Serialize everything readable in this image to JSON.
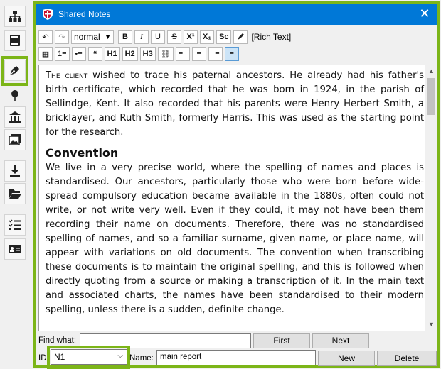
{
  "window": {
    "title": "Shared Notes",
    "close_glyph": "✕"
  },
  "rail": {
    "icons": [
      "tree-icon",
      "book-icon",
      "pen-nib-icon",
      "pin-icon",
      "museum-icon",
      "gallery-icon",
      "download-icon",
      "folder-open-icon",
      "checklist-icon",
      "id-card-icon"
    ]
  },
  "toolbar": {
    "undo": "↶",
    "redo": "↷",
    "style_select": "normal",
    "bold": "B",
    "italic": "I",
    "underline": "U",
    "strike": "S",
    "superscript": "X¹",
    "subscript": "X₁",
    "smallcaps": "Sc",
    "rich_text_label": "[Rich Text]",
    "table": "▦",
    "numbered_list": "1≡",
    "bullet_list": "•≡",
    "quote": "❝",
    "h1": "H1",
    "h2": "H2",
    "h3": "H3",
    "link": "⛓",
    "align_left": "≡",
    "align_center": "≡",
    "align_right": "≡",
    "align_justify": "≡"
  },
  "editor": {
    "para1_smallcaps": "The client",
    "para1_rest": " wished to trace his paternal ancestors. He already had his father's birth certificate, which recorded that he was born in 1924, in the parish of Sellindge, Kent. It also recorded that his parents were Henry Herbert Smith, a bricklayer, and Ruth Smith, formerly Harris. This was used as the starting point for the research.",
    "heading": "Convention",
    "para2": "We live in a very precise world, where the spelling of names and places is standardised. Our ancestors, particularly those who were born before wide-spread compulsory education became available in the 1880s, often could not write, or not write very well. Even if they could, it may not have been them recording their name on documents. Therefore, there was no standardised spelling of names, and so a familiar surname, given name, or place name, will appear with variations on old documents. The convention when transcribing these documents is to maintain the original spelling, and this is followed when directly quoting from a source or making a transcription of it. In the main text and associated charts, the names have been standardised to their modern spelling, unless there is a sudden, definite change."
  },
  "find": {
    "label": "Find what:",
    "value": "",
    "first_button": "First",
    "next_button": "Next"
  },
  "record": {
    "id_label": "ID:",
    "id_value": "N1",
    "name_label": "Name:",
    "name_value": "main report",
    "new_button": "New",
    "delete_button": "Delete"
  },
  "colors": {
    "accent_highlight": "#7cb518",
    "titlebar": "#0078d7"
  }
}
